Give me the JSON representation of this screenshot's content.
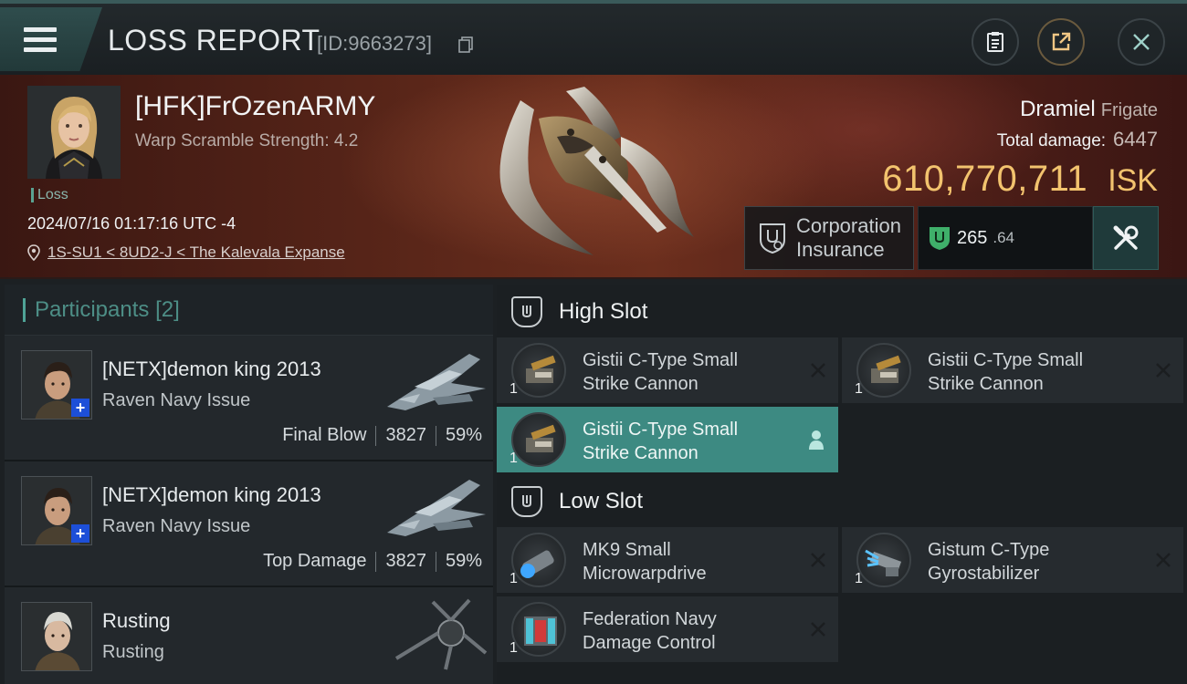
{
  "topbar": {
    "title": "LOSS REPORT",
    "id_label": "[ID:9663273]"
  },
  "victim": {
    "name": "[HFK]FrOzenARMY",
    "warp_scramble": "Warp Scramble Strength: 4.2",
    "status": "Loss",
    "datetime": "2024/07/16 01:17:16 UTC -4",
    "location": "1S-SU1 < 8UD2-J < The Kalevala Expanse"
  },
  "ship": {
    "name": "Dramiel",
    "class": "Frigate",
    "total_damage_label": "Total damage:",
    "total_damage": "6447",
    "isk_value": "610,770,711",
    "isk_unit": "ISK"
  },
  "insurance": {
    "label_line1": "Corporation",
    "label_line2": "Insurance",
    "amount_int": "265",
    "amount_frac": ".64"
  },
  "participants": {
    "header": "Participants",
    "count": "[2]",
    "rows": [
      {
        "name": "[NETX]demon king 2013",
        "ship": "Raven Navy Issue",
        "tag": "Final Blow",
        "damage": "3827",
        "percent": "59%"
      },
      {
        "name": "[NETX]demon king 2013",
        "ship": "Raven Navy Issue",
        "tag": "Top Damage",
        "damage": "3827",
        "percent": "59%"
      },
      {
        "name": "Rusting",
        "ship": "Rusting"
      }
    ]
  },
  "fitting": {
    "high_slot": {
      "title": "High Slot",
      "modules": [
        {
          "line1": "Gistii C-Type Small",
          "line2": "Strike Cannon",
          "qty": "1"
        },
        {
          "line1": "Gistii C-Type Small",
          "line2": "Strike Cannon",
          "qty": "1"
        },
        {
          "line1": "Gistii C-Type Small",
          "line2": "Strike Cannon",
          "qty": "1"
        }
      ]
    },
    "low_slot": {
      "title": "Low Slot",
      "modules": [
        {
          "line1": "MK9 Small",
          "line2": "Microwarpdrive",
          "qty": "1"
        },
        {
          "line1": "Gistum C-Type",
          "line2": "Gyrostabilizer",
          "qty": "1"
        },
        {
          "line1": "Federation Navy",
          "line2": "Damage Control",
          "qty": "1"
        }
      ]
    }
  },
  "colors": {
    "accent_teal": "#3d8a82",
    "isk_gold": "#f2c36e",
    "banner_red": "#5a2619"
  }
}
